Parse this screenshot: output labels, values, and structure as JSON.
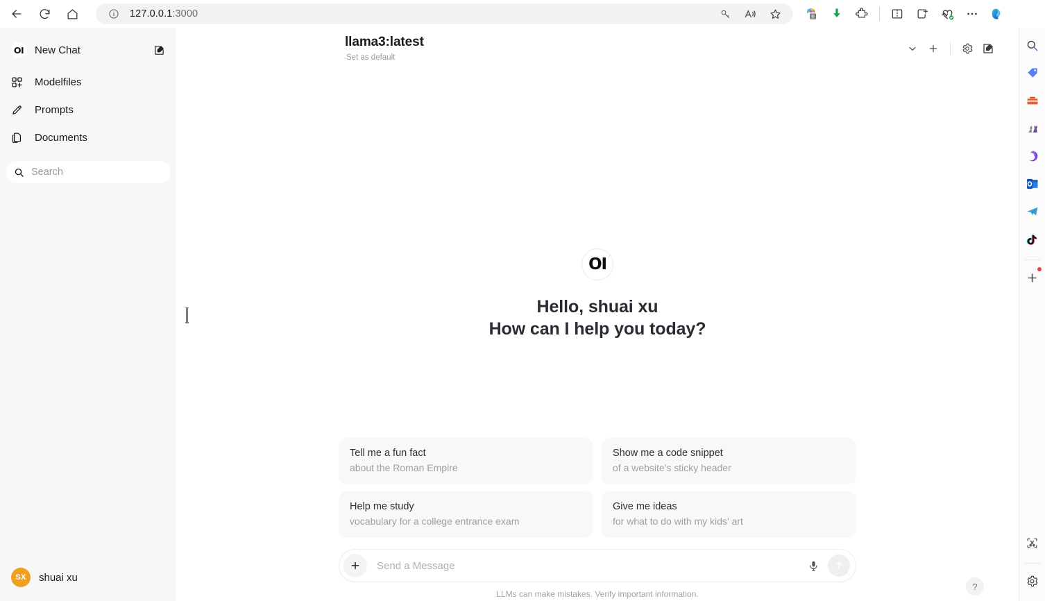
{
  "browser": {
    "url_host": "127.0.0.1",
    "url_port": ":3000",
    "back_icon": "back-arrow-icon",
    "refresh_icon": "refresh-icon",
    "home_icon": "home-icon",
    "info_icon": "site-info-icon",
    "key_icon": "password-key-icon",
    "read_aloud_icon": "read-aloud-icon",
    "favorite_icon": "add-favorite-star-icon",
    "toolbar_icons": [
      "translate-extension-icon",
      "downloads-icon",
      "extensions-puzzle-icon",
      "split-screen-icon",
      "add-collection-icon",
      "browser-essentials-icon",
      "settings-more-icon",
      "copilot-icon"
    ]
  },
  "edge_sidebar": {
    "icons": [
      "search-icon",
      "shopping-tag-icon",
      "tools-toolbox-icon",
      "games-icon",
      "microsoft365-icon",
      "outlook-icon",
      "telegram-icon",
      "tiktok-icon",
      "add-sidebar-app-icon",
      "screenshot-snip-icon",
      "sidebar-settings-icon"
    ]
  },
  "sidebar": {
    "new_chat": {
      "label": "New Chat",
      "logo_text": "OI",
      "edit_icon": "compose-edit-icon"
    },
    "items": [
      {
        "label": "Modelfiles",
        "icon": "modelfiles-grid-icon"
      },
      {
        "label": "Prompts",
        "icon": "pencil-icon"
      },
      {
        "label": "Documents",
        "icon": "documents-icon"
      }
    ],
    "search": {
      "placeholder": "Search",
      "value": "",
      "icon": "search-icon"
    },
    "user": {
      "name": "shuai xu",
      "initials": "SX",
      "avatar_color": "#f0a020"
    }
  },
  "header": {
    "model_name": "llama3:latest",
    "set_default_label": "Set as default",
    "actions": [
      {
        "name": "model-dropdown-chevron",
        "icon": "chevron-down-icon"
      },
      {
        "name": "add-model-button",
        "icon": "plus-icon"
      },
      {
        "name": "chat-settings-button",
        "icon": "gear-icon"
      },
      {
        "name": "new-chat-compose-button",
        "icon": "compose-edit-icon"
      }
    ]
  },
  "welcome": {
    "logo_text": "OI",
    "greeting_line1": "Hello, shuai xu",
    "greeting_line2": "How can I help you today?"
  },
  "suggestions": [
    {
      "title": "Tell me a fun fact",
      "subtitle": "about the Roman Empire"
    },
    {
      "title": "Show me a code snippet",
      "subtitle": "of a website's sticky header"
    },
    {
      "title": "Help me study",
      "subtitle": "vocabulary for a college entrance exam"
    },
    {
      "title": "Give me ideas",
      "subtitle": "for what to do with my kids' art"
    }
  ],
  "composer": {
    "placeholder": "Send a Message",
    "value": "",
    "plus_icon": "plus-attach-icon",
    "mic_icon": "microphone-icon",
    "send_icon": "send-arrow-up-icon",
    "disclaimer": "LLMs can make mistakes. Verify important information."
  },
  "help": {
    "label": "?"
  },
  "colors": {
    "sidebar_bg": "#f7f7f7",
    "card_bg": "#f8f8f8",
    "accent_avatar": "#f0a020",
    "text_primary": "#1a1a1a",
    "text_muted": "#a0a0a0"
  }
}
